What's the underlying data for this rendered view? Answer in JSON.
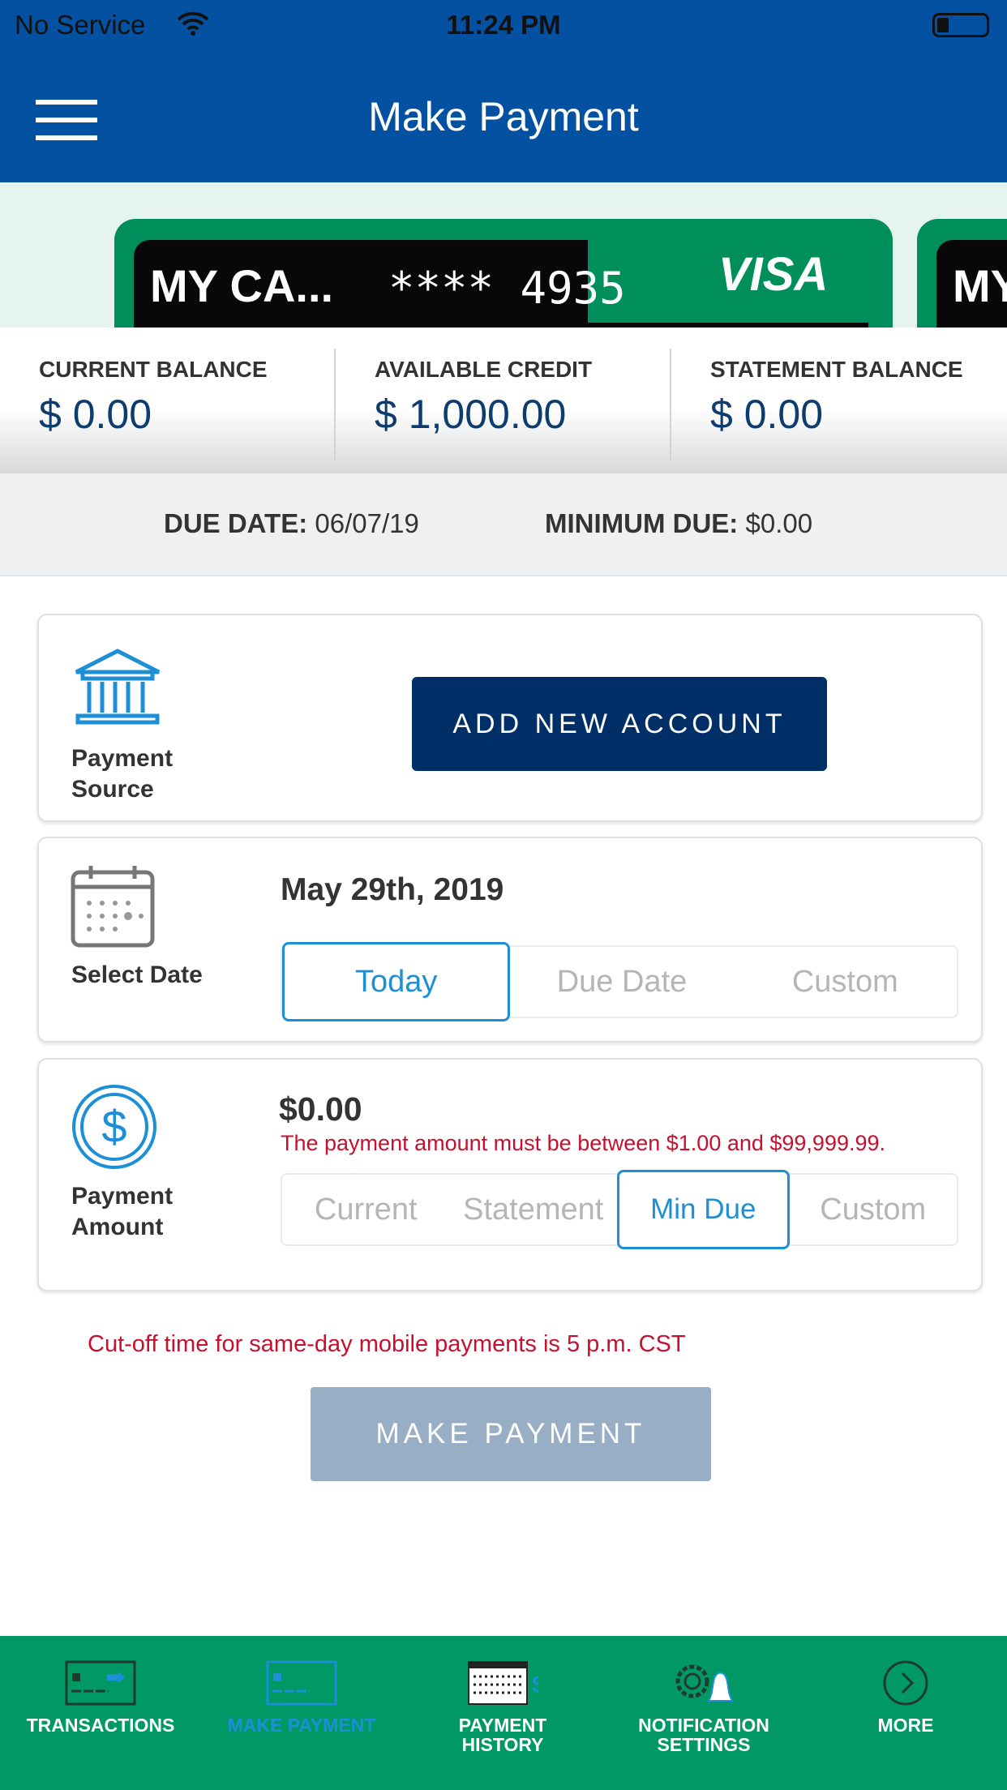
{
  "status_bar": {
    "carrier": "No Service",
    "time": "11:24 PM"
  },
  "header": {
    "title": "Make Payment"
  },
  "cards": [
    {
      "name": "MY CA...",
      "number": "**** 4935",
      "brand": "VISA"
    },
    {
      "name": "MY"
    }
  ],
  "balances": [
    {
      "label": "CURRENT BALANCE",
      "value": "$ 0.00"
    },
    {
      "label": "AVAILABLE CREDIT",
      "value": "$ 1,000.00"
    },
    {
      "label": "STATEMENT BALANCE",
      "value": "$ 0.00"
    }
  ],
  "due": {
    "due_label": "DUE DATE:",
    "due_value": "06/07/19",
    "min_label": "MINIMUM DUE:",
    "min_value": "$0.00"
  },
  "payment_source": {
    "label_1": "Payment",
    "label_2": "Source",
    "button": "ADD NEW ACCOUNT"
  },
  "select_date": {
    "label": "Select Date",
    "date": "May 29th, 2019",
    "options": [
      "Today",
      "Due Date",
      "Custom"
    ],
    "selected": "Today"
  },
  "payment_amount": {
    "label_1": "Payment",
    "label_2": "Amount",
    "amount": "$0.00",
    "error": "The payment amount must be between $1.00 and $99,999.99.",
    "options": [
      "Current",
      "Statement",
      "Min Due",
      "Custom"
    ],
    "selected": "Min Due"
  },
  "cutoff_note": "Cut-off time for same-day mobile payments is 5 p.m. CST",
  "make_payment_button": "MAKE PAYMENT",
  "tabs": [
    {
      "l1": "TRANSACTIONS",
      "l2": ""
    },
    {
      "l1": "MAKE PAYMENT",
      "l2": "",
      "active": true
    },
    {
      "l1": "PAYMENT",
      "l2": "HISTORY"
    },
    {
      "l1": "NOTIFICATION",
      "l2": "SETTINGS"
    },
    {
      "l1": "MORE",
      "l2": ""
    }
  ],
  "colors": {
    "header": "#0451a1",
    "tabbar": "#009966",
    "accent": "#1c8fd6",
    "button": "#002f68",
    "error": "#c8102e",
    "disabled_button": "#97aec4"
  }
}
